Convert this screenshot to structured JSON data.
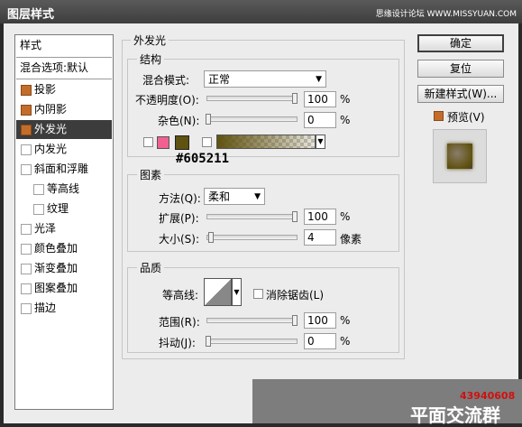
{
  "window": {
    "title": "图层样式",
    "watermark_site": "思缘设计论坛 WWW.MISSYUAN.COM"
  },
  "stylelist": {
    "header": "样式",
    "blend_default": "混合选项:默认",
    "items": [
      {
        "label": "投影",
        "checked": true,
        "selected": false
      },
      {
        "label": "内阴影",
        "checked": true,
        "selected": false
      },
      {
        "label": "外发光",
        "checked": true,
        "selected": true
      },
      {
        "label": "内发光",
        "checked": false,
        "selected": false
      },
      {
        "label": "斜面和浮雕",
        "checked": false,
        "selected": false
      },
      {
        "label": "等高线",
        "checked": false,
        "selected": false,
        "sub": true
      },
      {
        "label": "纹理",
        "checked": false,
        "selected": false,
        "sub": true
      },
      {
        "label": "光泽",
        "checked": false,
        "selected": false
      },
      {
        "label": "颜色叠加",
        "checked": false,
        "selected": false
      },
      {
        "label": "渐变叠加",
        "checked": false,
        "selected": false
      },
      {
        "label": "图案叠加",
        "checked": false,
        "selected": false
      },
      {
        "label": "描边",
        "checked": false,
        "selected": false
      }
    ]
  },
  "outer_glow": {
    "title": "外发光",
    "structure": {
      "title": "结构",
      "blend_mode_label": "混合模式:",
      "blend_mode_value": "正常",
      "opacity_label": "不透明度(O):",
      "opacity_value": "100",
      "noise_label": "杂色(N):",
      "noise_value": "0",
      "percent": "%",
      "color_annotation": "#605211",
      "swatch_pink": "#f06090",
      "swatch_brown": "#605211"
    },
    "elements": {
      "title": "图素",
      "technique_label": "方法(Q):",
      "technique_value": "柔和",
      "spread_label": "扩展(P):",
      "spread_value": "100",
      "size_label": "大小(S):",
      "size_value": "4",
      "px_unit": "像素",
      "percent": "%"
    },
    "quality": {
      "title": "品质",
      "contour_label": "等高线:",
      "antialias_label": "消除锯齿(L)",
      "range_label": "范围(R):",
      "range_value": "100",
      "jitter_label": "抖动(J):",
      "jitter_value": "0",
      "percent": "%"
    }
  },
  "buttons": {
    "ok": "确定",
    "reset": "复位",
    "new_style": "新建样式(W)...",
    "preview": "预览(V)"
  },
  "watermark": {
    "qq": "43940608",
    "group": "平面交流群"
  }
}
